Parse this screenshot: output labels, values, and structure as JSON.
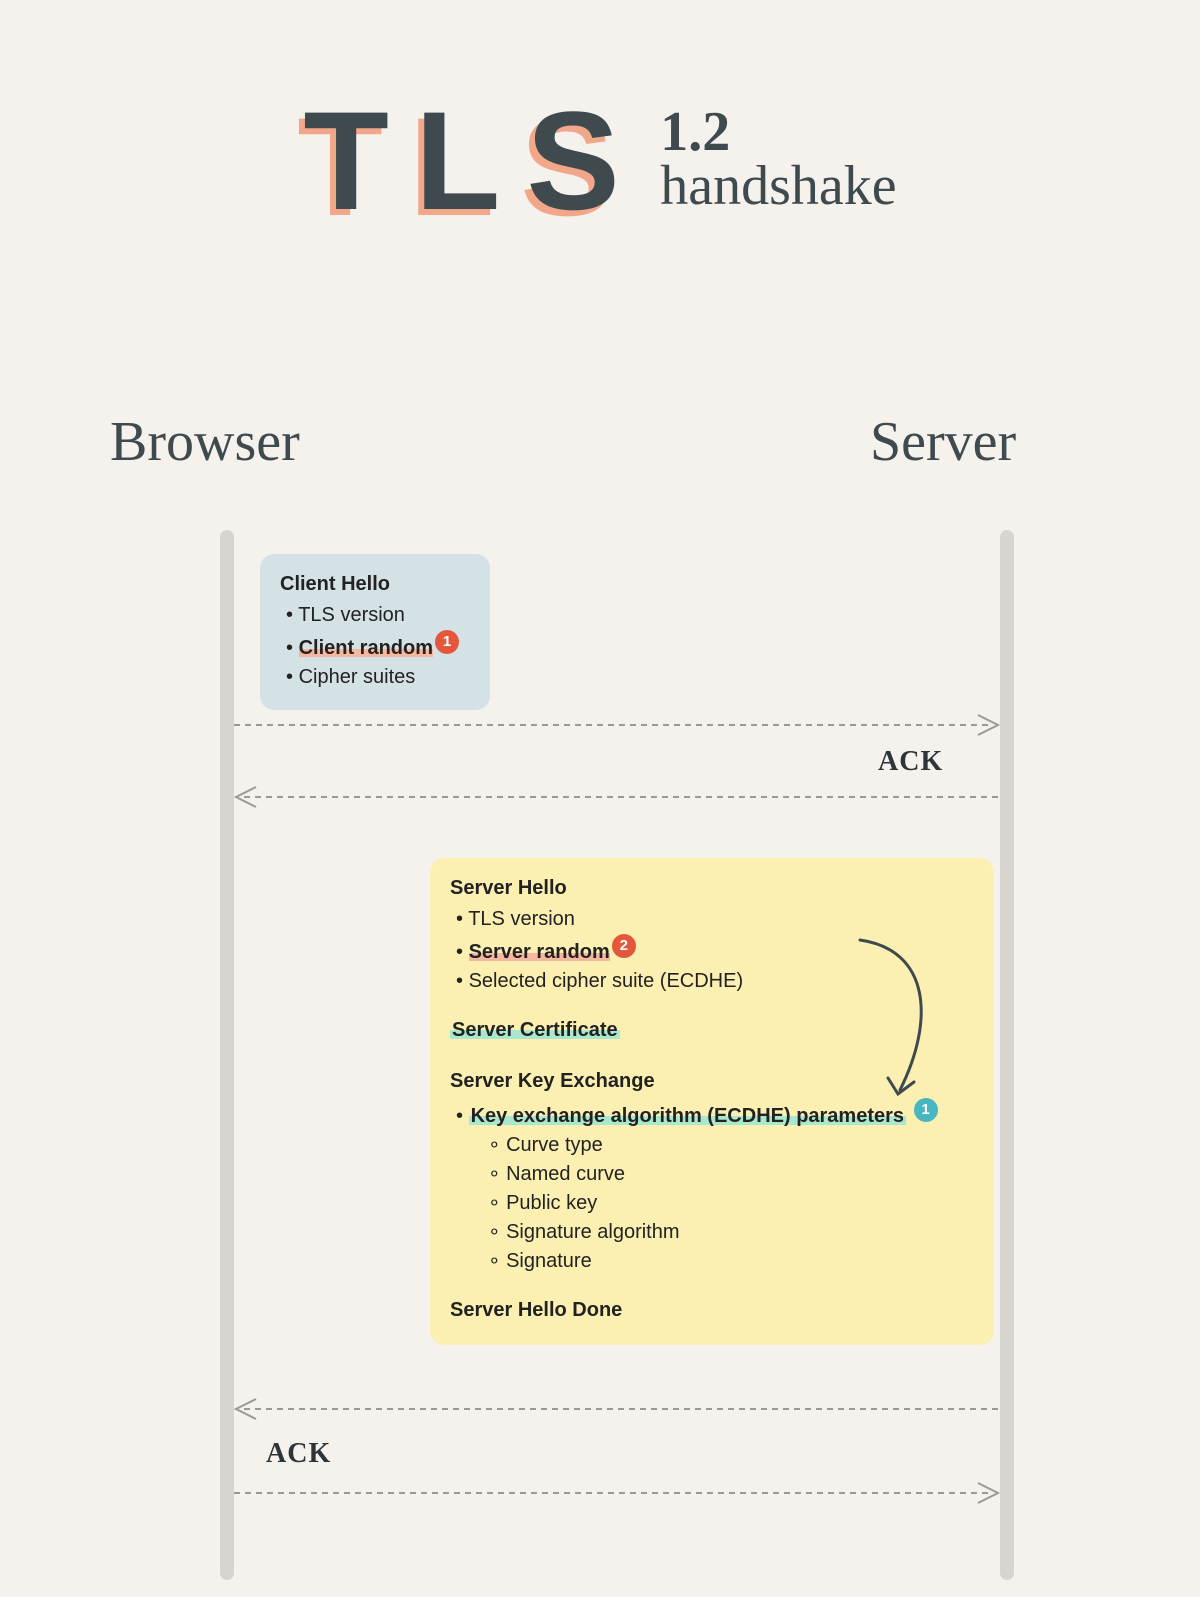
{
  "title": {
    "main": "TLS",
    "version": "1.2",
    "subtitle": "handshake"
  },
  "actors": {
    "left": "Browser",
    "right": "Server"
  },
  "client_hello": {
    "heading": "Client Hello",
    "items": [
      "TLS version",
      "Client random",
      "Cipher suites"
    ],
    "highlight_index": 1,
    "badge": "1"
  },
  "ack1": "ACK",
  "server_block": {
    "hello": {
      "heading": "Server Hello",
      "items": [
        "TLS version",
        "Server random",
        "Selected cipher suite (ECDHE)"
      ],
      "highlight_index": 1,
      "badge": "2"
    },
    "certificate": "Server Certificate",
    "key_exchange": {
      "heading": "Server Key Exchange",
      "item": "Key exchange algorithm (ECDHE) parameters",
      "badge": "1",
      "subitems": [
        "Curve type",
        "Named curve",
        "Public key",
        "Signature algorithm",
        "Signature"
      ]
    },
    "done": "Server Hello Done"
  },
  "ack2": "ACK"
}
